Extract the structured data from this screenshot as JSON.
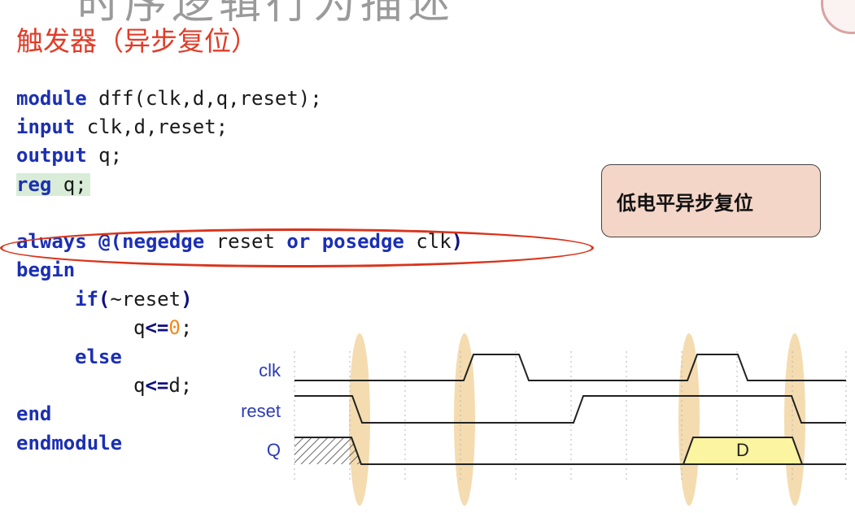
{
  "slide": {
    "top_title": "时序逻辑行为描述",
    "subtitle": "触发器（异步复位）"
  },
  "code": {
    "lines": [
      {
        "kw1": "module",
        "rest": " dff(clk,d,q,reset);"
      },
      {
        "kw1": "input",
        "rest": " clk,d,reset;"
      },
      {
        "kw1": "output",
        "rest": " q;"
      },
      {
        "kw1": "reg",
        "rest": " q;"
      },
      {
        "always": "always",
        "at": "@(",
        "negedge": "negedge",
        "mid": " reset ",
        "or": "or",
        "posedge": "posedge",
        "tail": " clk",
        "close": ")"
      },
      {
        "kw1": "begin"
      },
      {
        "if_kw": "if",
        "if_open": "(",
        "if_cond": "~reset",
        "if_close": ")"
      },
      {
        "q1": "q",
        "assign": "<=",
        "zero": "0",
        "semi": ";"
      },
      {
        "else_kw": "else"
      },
      {
        "q2": "q",
        "assign2": "<=",
        "d": "d;"
      },
      {
        "kw1": "end"
      },
      {
        "kw1": "endmodule"
      }
    ]
  },
  "callout": {
    "text": "低电平异步复位"
  },
  "timing": {
    "signals": [
      "clk",
      "reset",
      "Q"
    ],
    "q_value": "D",
    "colors": {
      "highlight": "#f4dcb0",
      "q_fill": "#fbf4a0",
      "waveform": "#222222",
      "label": "#2b3bb5"
    }
  }
}
